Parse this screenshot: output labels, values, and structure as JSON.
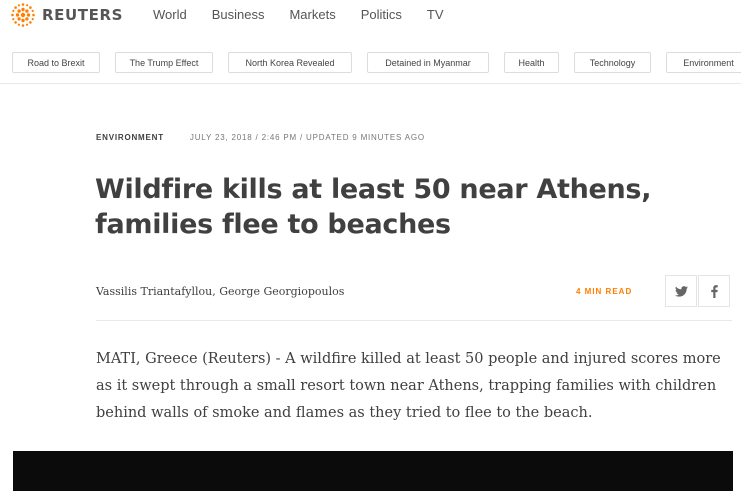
{
  "brand": {
    "name": "REUTERS",
    "accent": "#ff8000"
  },
  "nav": {
    "items": [
      "World",
      "Business",
      "Markets",
      "Politics",
      "TV"
    ]
  },
  "topics": [
    "Road to Brexit",
    "The Trump Effect",
    "North Korea Revealed",
    "Detained in Myanmar",
    "Health",
    "Technology",
    "Environment"
  ],
  "article": {
    "section": "ENVIRONMENT",
    "dateline": "JULY 23, 2018 / 2:46 PM / UPDATED 9 MINUTES AGO",
    "headline": "Wildfire kills at least 50 near Athens, families flee to beaches",
    "byline": "Vassilis Triantafyllou, George Georgiopoulos",
    "read_time": "4 MIN READ",
    "lead": "MATI, Greece (Reuters) - A wildfire killed at least 50 people and injured scores more as it swept through a small resort town near Athens, trapping families with children behind walls of smoke and flames as they tried to flee to the beach."
  },
  "share": {
    "twitter_icon": "twitter-icon",
    "facebook_icon": "facebook-icon"
  }
}
